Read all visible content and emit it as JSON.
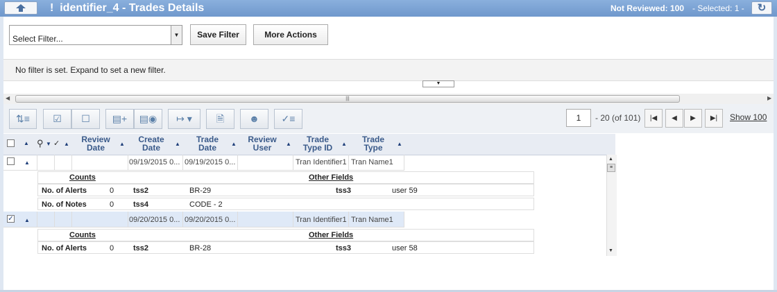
{
  "header": {
    "bang": "!",
    "title": "identifier_4 - Trades Details",
    "not_reviewed": "Not Reviewed: 100",
    "selected": "- Selected: 1 -",
    "up_icon": "up-arrow-icon",
    "refresh_icon": "refresh-icon"
  },
  "filter": {
    "select_value": "Select Filter...",
    "save_label": "Save Filter",
    "more_actions_label": "More Actions",
    "message": "No filter is set. Expand to set a new filter."
  },
  "pager": {
    "page": "1",
    "range": "- 20 (of 101)",
    "show_label": "Show 100"
  },
  "columns": [
    {
      "label_line1": "Review",
      "label_line2": "Date"
    },
    {
      "label_line1": "Create",
      "label_line2": "Date"
    },
    {
      "label_line1": "Trade",
      "label_line2": "Date"
    },
    {
      "label_line1": "Review",
      "label_line2": "User"
    },
    {
      "label_line1": "Trade",
      "label_line2": "Type ID"
    },
    {
      "label_line1": "Trade",
      "label_line2": "Type"
    }
  ],
  "rows": [
    {
      "checked": false,
      "create_date": "09/19/2015 0...",
      "trade_date": "09/19/2015 0...",
      "trade_type_id": "Tran Identifier1",
      "trade_type": "Tran Name1",
      "counts_label": "Counts",
      "other_label": "Other Fields",
      "alerts_label": "No. of Alerts",
      "alerts": "0",
      "notes_label": "No. of Notes",
      "notes": "0",
      "f1_label": "tss2",
      "f1_value": "BR-29",
      "f2_label": "tss3",
      "f2_value": "user 59",
      "f3_label": "tss4",
      "f3_value": "CODE - 2"
    },
    {
      "checked": true,
      "create_date": "09/20/2015 0...",
      "trade_date": "09/20/2015 0...",
      "trade_type_id": "Tran Identifier1",
      "trade_type": "Tran Name1",
      "counts_label": "Counts",
      "other_label": "Other Fields",
      "alerts_label": "No. of Alerts",
      "alerts": "0",
      "f1_label": "tss2",
      "f1_value": "BR-28",
      "f2_label": "tss3",
      "f2_value": "user 58"
    }
  ],
  "colors": {
    "titlebar": "#7aa2d4",
    "header_text": "#3a5a8a",
    "selected_row": "#dfe9f7"
  }
}
